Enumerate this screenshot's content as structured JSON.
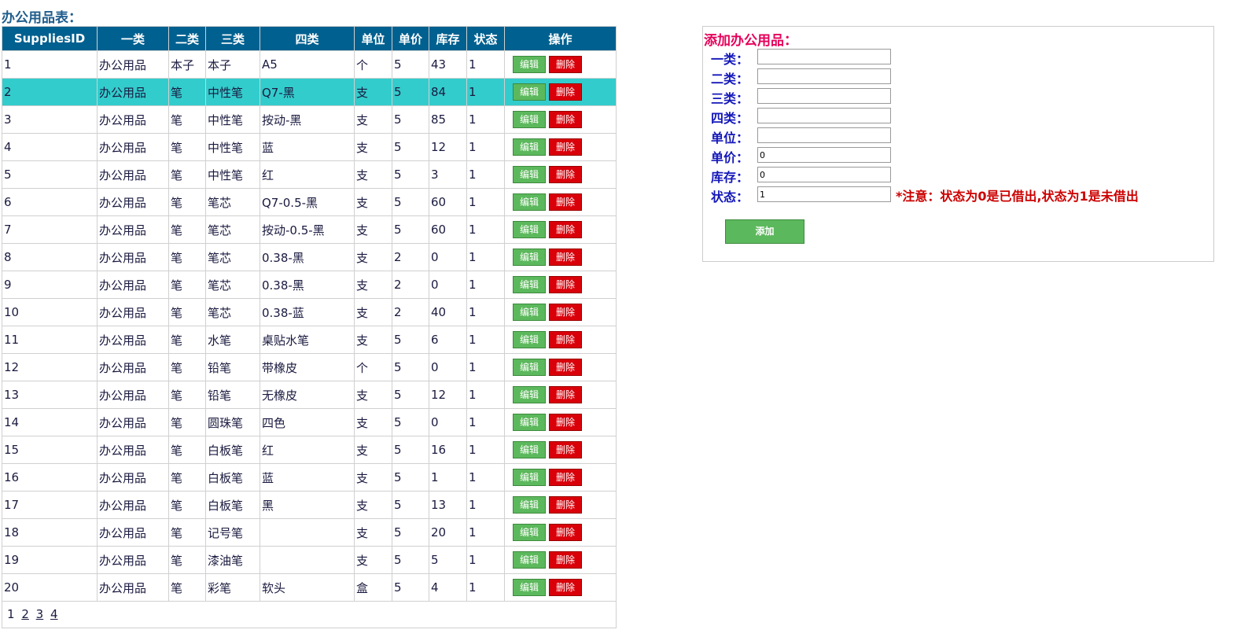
{
  "table_title": "办公用品表：",
  "columns": [
    "SuppliesID",
    "一类",
    "二类",
    "三类",
    "四类",
    "单位",
    "单价",
    "库存",
    "状态",
    "操作"
  ],
  "edit_label": "编辑",
  "delete_label": "删除",
  "rows": [
    [
      "1",
      "办公用品",
      "本子",
      "本子",
      "A5",
      "个",
      "5",
      "43",
      "1"
    ],
    [
      "2",
      "办公用品",
      "笔",
      "中性笔",
      "Q7-黑",
      "支",
      "5",
      "84",
      "1"
    ],
    [
      "3",
      "办公用品",
      "笔",
      "中性笔",
      "按动-黑",
      "支",
      "5",
      "85",
      "1"
    ],
    [
      "4",
      "办公用品",
      "笔",
      "中性笔",
      "蓝",
      "支",
      "5",
      "12",
      "1"
    ],
    [
      "5",
      "办公用品",
      "笔",
      "中性笔",
      "红",
      "支",
      "5",
      "3",
      "1"
    ],
    [
      "6",
      "办公用品",
      "笔",
      "笔芯",
      "Q7-0.5-黑",
      "支",
      "5",
      "60",
      "1"
    ],
    [
      "7",
      "办公用品",
      "笔",
      "笔芯",
      "按动-0.5-黑",
      "支",
      "5",
      "60",
      "1"
    ],
    [
      "8",
      "办公用品",
      "笔",
      "笔芯",
      "0.38-黑",
      "支",
      "2",
      "0",
      "1"
    ],
    [
      "9",
      "办公用品",
      "笔",
      "笔芯",
      "0.38-黑",
      "支",
      "2",
      "0",
      "1"
    ],
    [
      "10",
      "办公用品",
      "笔",
      "笔芯",
      "0.38-蓝",
      "支",
      "2",
      "40",
      "1"
    ],
    [
      "11",
      "办公用品",
      "笔",
      "水笔",
      "桌贴水笔",
      "支",
      "5",
      "6",
      "1"
    ],
    [
      "12",
      "办公用品",
      "笔",
      "铅笔",
      "带橡皮",
      "个",
      "5",
      "0",
      "1"
    ],
    [
      "13",
      "办公用品",
      "笔",
      "铅笔",
      "无橡皮",
      "支",
      "5",
      "12",
      "1"
    ],
    [
      "14",
      "办公用品",
      "笔",
      "圆珠笔",
      "四色",
      "支",
      "5",
      "0",
      "1"
    ],
    [
      "15",
      "办公用品",
      "笔",
      "白板笔",
      "红",
      "支",
      "5",
      "16",
      "1"
    ],
    [
      "16",
      "办公用品",
      "笔",
      "白板笔",
      "蓝",
      "支",
      "5",
      "1",
      "1"
    ],
    [
      "17",
      "办公用品",
      "笔",
      "白板笔",
      "黑",
      "支",
      "5",
      "13",
      "1"
    ],
    [
      "18",
      "办公用品",
      "笔",
      "记号笔",
      "",
      "支",
      "5",
      "20",
      "1"
    ],
    [
      "19",
      "办公用品",
      "笔",
      "漆油笔",
      "",
      "支",
      "5",
      "5",
      "1"
    ],
    [
      "20",
      "办公用品",
      "笔",
      "彩笔",
      "软头",
      "盒",
      "5",
      "4",
      "1"
    ]
  ],
  "pager": {
    "current": "1",
    "links": [
      "2",
      "3",
      "4"
    ]
  },
  "form": {
    "title": "添加办公用品：",
    "fields": [
      {
        "label": "一类：",
        "value": ""
      },
      {
        "label": "二类：",
        "value": ""
      },
      {
        "label": "三类：",
        "value": ""
      },
      {
        "label": "四类：",
        "value": ""
      },
      {
        "label": "单位：",
        "value": ""
      },
      {
        "label": "单价：",
        "value": "0"
      },
      {
        "label": "库存：",
        "value": "0"
      },
      {
        "label": "状态：",
        "value": "1"
      }
    ],
    "note": "*注意：状态为0是已借出,状态为1是未借出",
    "submit_label": "添加"
  },
  "colors": {
    "header_bg": "#00608f",
    "highlight_row": "#33cccc",
    "edit_btn": "#5cb85c",
    "delete_btn": "#d9000a",
    "form_title": "#e6005a",
    "form_label": "#1418b8",
    "note": "#cc0000"
  }
}
